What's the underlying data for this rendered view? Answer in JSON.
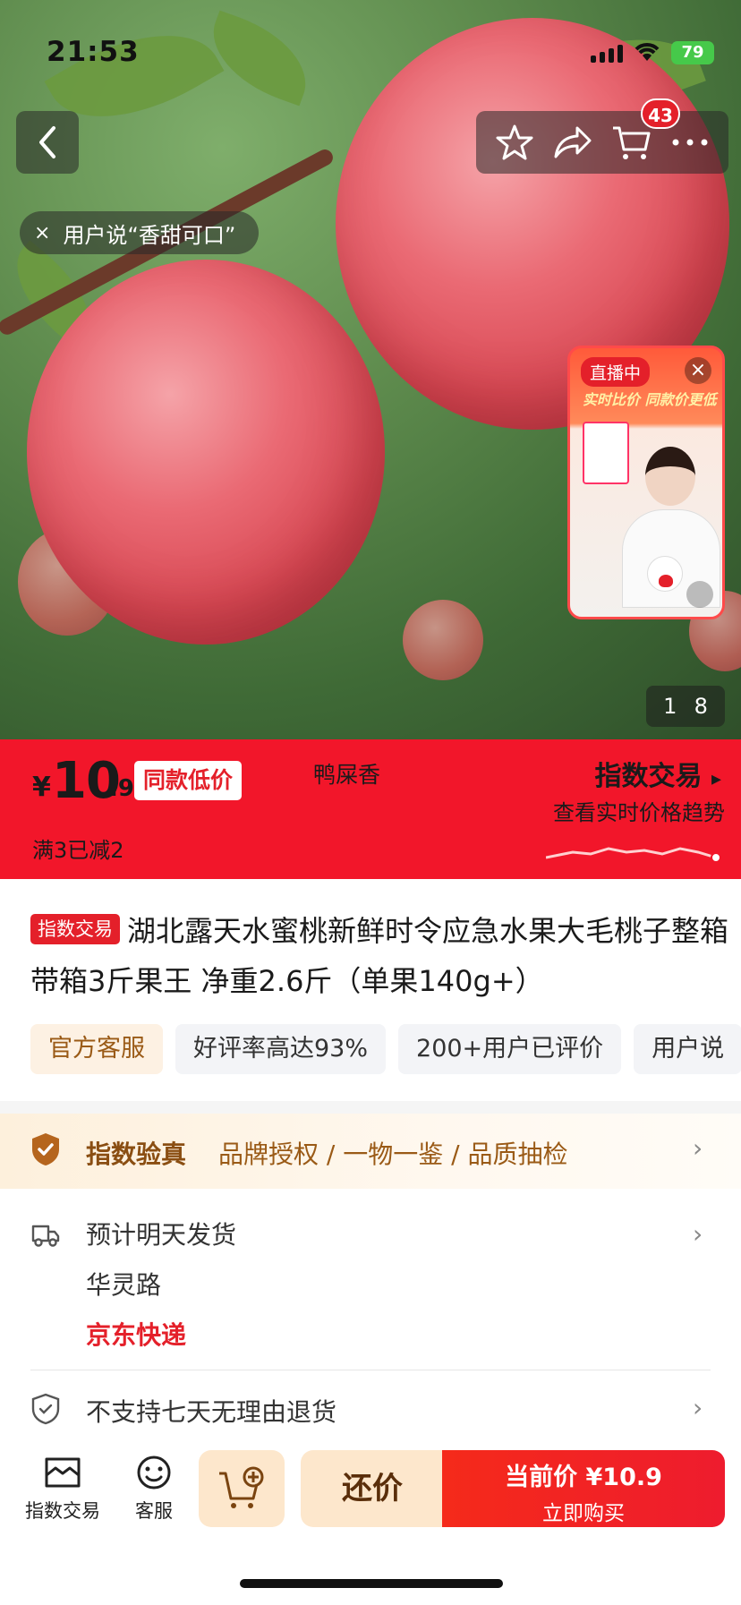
{
  "status_bar": {
    "time": "21:53",
    "battery": "79"
  },
  "header": {
    "cart_badge": "43"
  },
  "review_chip": {
    "close": "×",
    "text": "用户说“香甜可口”"
  },
  "live": {
    "tag": "直播中",
    "close": "×",
    "subtitle": "实时比价 同款价更低"
  },
  "image_counter": {
    "current": "1",
    "total": "8"
  },
  "price": {
    "currency": "¥",
    "integer": "10",
    "decimal": ".9",
    "tag": "同款低价",
    "variant": "鸭屎香",
    "discount": "满3已减2",
    "index_title": "指数交易",
    "index_arrow": "▸",
    "index_subtitle": "查看实时价格趋势"
  },
  "product": {
    "badge": "指数交易",
    "title": "湖北露天水蜜桃新鲜时令应急水果大毛桃子整箱 带箱3斤果王 净重2.6斤（单果140g+）",
    "chips": [
      "官方客服",
      "好评率高达93%",
      "200+用户已评价",
      "用户说"
    ]
  },
  "verify": {
    "title": "指数验真",
    "items": "品牌授权 / 一物一鉴 / 品质抽检",
    "chevron": "›"
  },
  "shipping": {
    "line1": "预计明天发货",
    "line2": "华灵路",
    "courier": "京东快递",
    "chevron": "›"
  },
  "returns": {
    "text": "不支持七天无理由退货",
    "chevron": "›"
  },
  "bottom_bar": {
    "nav": [
      {
        "label": "指数交易",
        "icon": "storefront-icon"
      },
      {
        "label": "客服",
        "icon": "smiley-icon"
      }
    ],
    "haggle": "还价",
    "buy_top": "当前价 ¥10.9",
    "buy_bottom": "立即购买"
  },
  "colors": {
    "accent": "#f2162a",
    "gold": "#9a5a16",
    "cream": "#fde7cc"
  }
}
